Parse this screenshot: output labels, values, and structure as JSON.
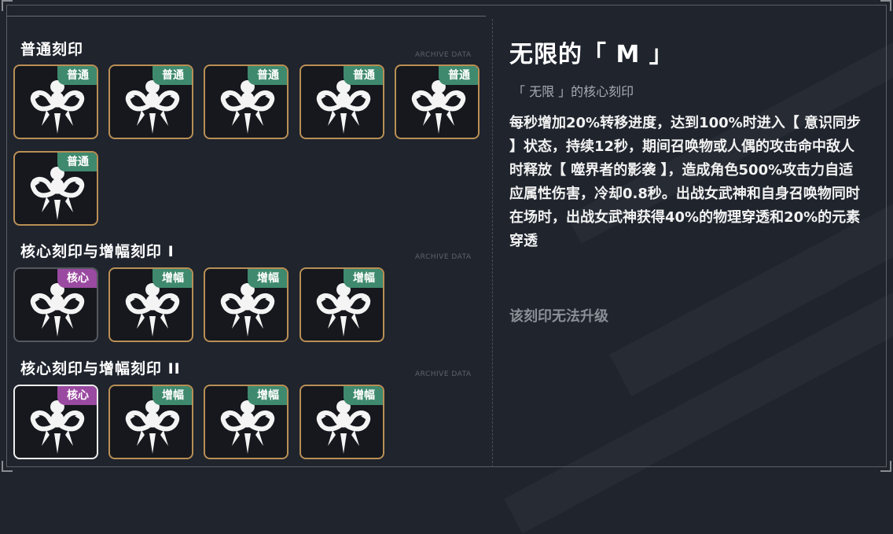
{
  "sections": [
    {
      "title": "普通刻印",
      "tag": "ARCHIVE DATA"
    },
    {
      "title": "核心刻印与增幅刻印 I",
      "tag": "ARCHIVE DATA"
    },
    {
      "title": "核心刻印与增幅刻印 II",
      "tag": "ARCHIVE DATA"
    }
  ],
  "badges": {
    "normal": "普通",
    "core": "核心",
    "amp": "增幅"
  },
  "cards": {
    "row1": [
      "普通",
      "普通",
      "普通",
      "普通",
      "普通"
    ],
    "row2": [
      "普通"
    ],
    "row3": [
      "核心",
      "增幅",
      "增幅",
      "增幅"
    ],
    "row4": [
      "核心",
      "增幅",
      "增幅",
      "增幅"
    ]
  },
  "detail": {
    "title": "无限的「 M 」",
    "subtitle": "「 无限 」的核心刻印",
    "description": "每秒增加20%转移进度，达到100%时进入【 意识同步 】状态，持续12秒，期间召唤物或人偶的攻击命中敌人时释放【 噬界者的影袭 】，造成角色500%攻击力自适应属性伤害，冷却0.8秒。出战女武神和自身召唤物同时在场时，出战女武神获得40%的物理穿透和20%的元素穿透",
    "footer": "该刻印无法升级"
  },
  "colors": {
    "accent_normal": "#3f8a6e",
    "accent_core": "#9a4aa0",
    "card_border": "#b98f55"
  }
}
